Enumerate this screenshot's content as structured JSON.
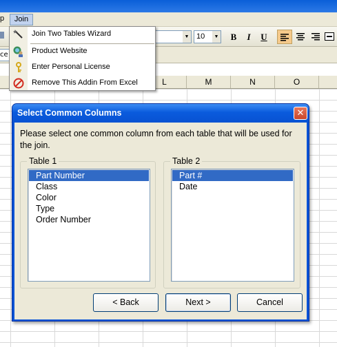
{
  "menubar": {
    "clipped_item": "p",
    "join_menu": "Join"
  },
  "toolbar": {
    "font_size": "10",
    "bold": "B",
    "italic": "I",
    "underline": "U"
  },
  "formulabar": {
    "namebox_text": "ce"
  },
  "columns": [
    "L",
    "M",
    "N",
    "O"
  ],
  "join_menu_items": [
    {
      "label": "Join Two Tables Wizard",
      "icon": "wizard-wand-icon"
    },
    {
      "label": "Product Website",
      "icon": "globe-person-icon"
    },
    {
      "label": "Enter Personal License",
      "icon": "key-icon"
    },
    {
      "label": "Remove This Addin From Excel",
      "icon": "no-entry-icon"
    }
  ],
  "dialog": {
    "title": "Select Common Columns",
    "instruction": "Please select one common column from each table that will be used for the join.",
    "table1": {
      "label": "Table 1",
      "items": [
        "Part Number",
        "Class",
        "Color",
        "Type",
        "Order Number"
      ],
      "selected_index": 0
    },
    "table2": {
      "label": "Table 2",
      "items": [
        "Part #",
        "Date"
      ],
      "selected_index": 0
    },
    "buttons": {
      "back": "< Back",
      "next": "Next >",
      "cancel": "Cancel"
    }
  },
  "colors": {
    "selection": "#316ac5",
    "title_blue": "#0a53d6",
    "close_red": "#c9462a"
  }
}
